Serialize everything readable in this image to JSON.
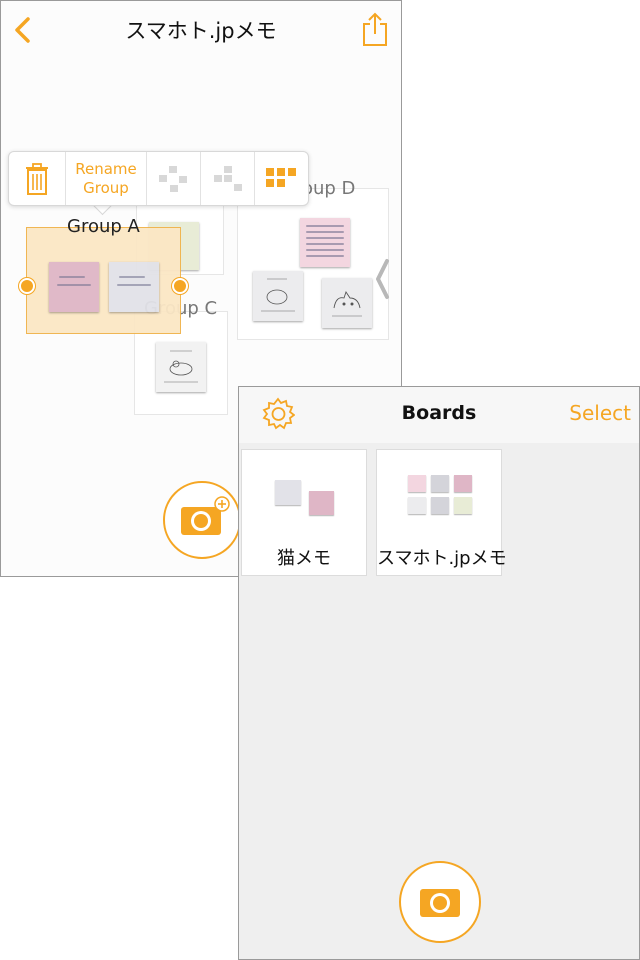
{
  "board_detail": {
    "title": "スマホト.jpメモ",
    "toolbar": {
      "rename_label": "Rename\nGroup"
    },
    "groups": {
      "a_label": "Group A",
      "c_label": "Group C",
      "d_label": "Group D"
    }
  },
  "boards_screen": {
    "title": "Boards",
    "select_label": "Select",
    "boards": [
      {
        "name": "猫メモ"
      },
      {
        "name": "スマホト.jpメモ"
      }
    ]
  },
  "colors": {
    "accent": "#f5a623",
    "selection_fill": "#fbe7c5",
    "pink_note": "#dfb6c6",
    "grey_note": "#e2e2e8",
    "green_note": "#e8ecd6"
  },
  "icons": [
    "back-chevron-icon",
    "share-icon",
    "trash-icon",
    "scatter-layout-icon",
    "diagonal-layout-icon",
    "grid-layout-icon",
    "chevron-right-icon",
    "camera-plus-icon",
    "gear-icon",
    "camera-icon"
  ]
}
